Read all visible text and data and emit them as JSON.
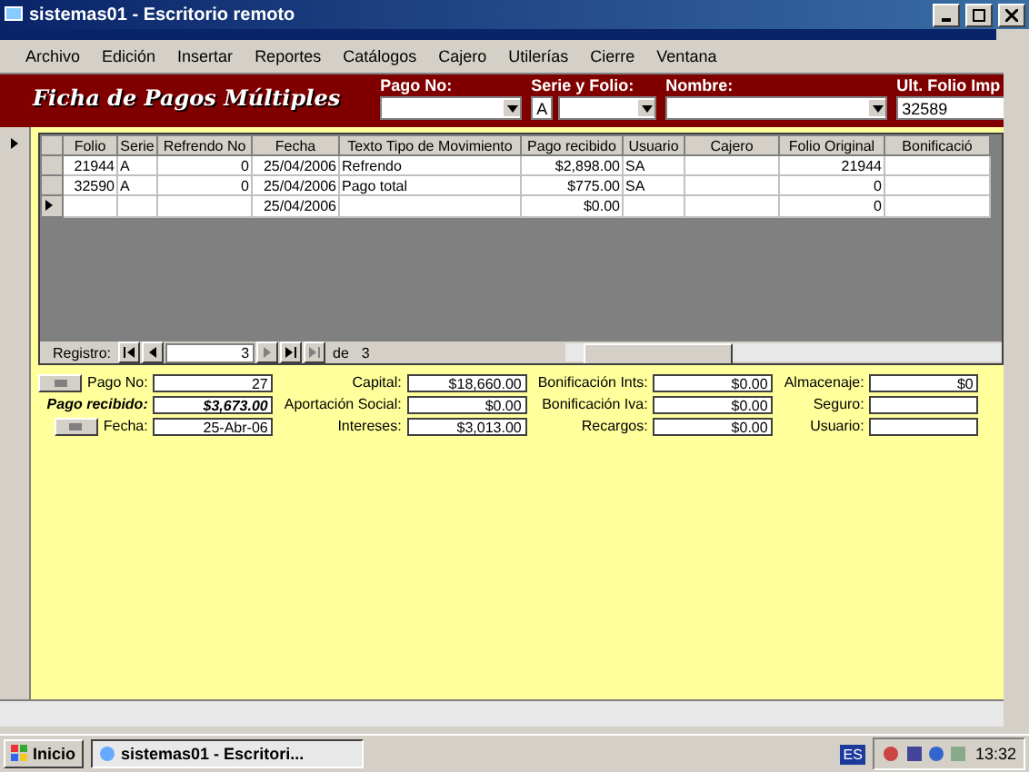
{
  "window": {
    "title": "sistemas01 - Escritorio remoto"
  },
  "menu": [
    "Archivo",
    "Edición",
    "Insertar",
    "Reportes",
    "Catálogos",
    "Cajero",
    "Utilerías",
    "Cierre",
    "Ventana"
  ],
  "header": {
    "title": "Ficha de Pagos Múltiples",
    "pago_no": {
      "label": "Pago No:"
    },
    "serie_folio": {
      "label": "Serie y Folio:",
      "serie": "A"
    },
    "nombre": {
      "label": "Nombre:"
    },
    "ult_folio": {
      "label": "Ult. Folio Imp",
      "value": "32589"
    }
  },
  "table": {
    "columns": [
      "Folio",
      "Serie",
      "Refrendo No",
      "Fecha",
      "Texto Tipo de Movimiento",
      "Pago recibido",
      "Usuario",
      "Cajero",
      "Folio Original",
      "Bonificació"
    ],
    "rows": [
      {
        "current": false,
        "cells": [
          "21944",
          "A",
          "0",
          "25/04/2006",
          "Refrendo",
          "$2,898.00",
          "SA",
          "",
          "21944",
          ""
        ]
      },
      {
        "current": false,
        "cells": [
          "32590",
          "A",
          "0",
          "25/04/2006",
          "Pago total",
          "$775.00",
          "SA",
          "",
          "0",
          ""
        ]
      },
      {
        "current": true,
        "cells": [
          "",
          "",
          "",
          "25/04/2006",
          "",
          "$0.00",
          "",
          "",
          "0",
          ""
        ]
      }
    ]
  },
  "navigator": {
    "label": "Registro:",
    "record": "3",
    "of_label": "de",
    "total": "3"
  },
  "details": {
    "left": [
      {
        "label": "Pago No:",
        "value": "27",
        "bold": false
      },
      {
        "label": "Pago recibido:",
        "value": "$3,673.00",
        "bold": true
      },
      {
        "label": "Fecha:",
        "value": "25-Abr-06",
        "bold": false
      }
    ],
    "columns": [
      [
        {
          "label": "Capital:",
          "value": "$18,660.00"
        },
        {
          "label": "Aportación Social:",
          "value": "$0.00"
        },
        {
          "label": "Intereses:",
          "value": "$3,013.00"
        }
      ],
      [
        {
          "label": "Bonificación Ints:",
          "value": "$0.00"
        },
        {
          "label": "Bonificación Iva:",
          "value": "$0.00"
        },
        {
          "label": "Recargos:",
          "value": "$0.00"
        }
      ],
      [
        {
          "label": "Almacenaje:",
          "value": "$0"
        },
        {
          "label": "Seguro:"
        },
        {
          "label": "Usuario:"
        }
      ]
    ]
  },
  "taskbar": {
    "start": "Inicio",
    "task": "sistemas01 - Escritori...",
    "language": "ES",
    "clock": "13:32"
  }
}
